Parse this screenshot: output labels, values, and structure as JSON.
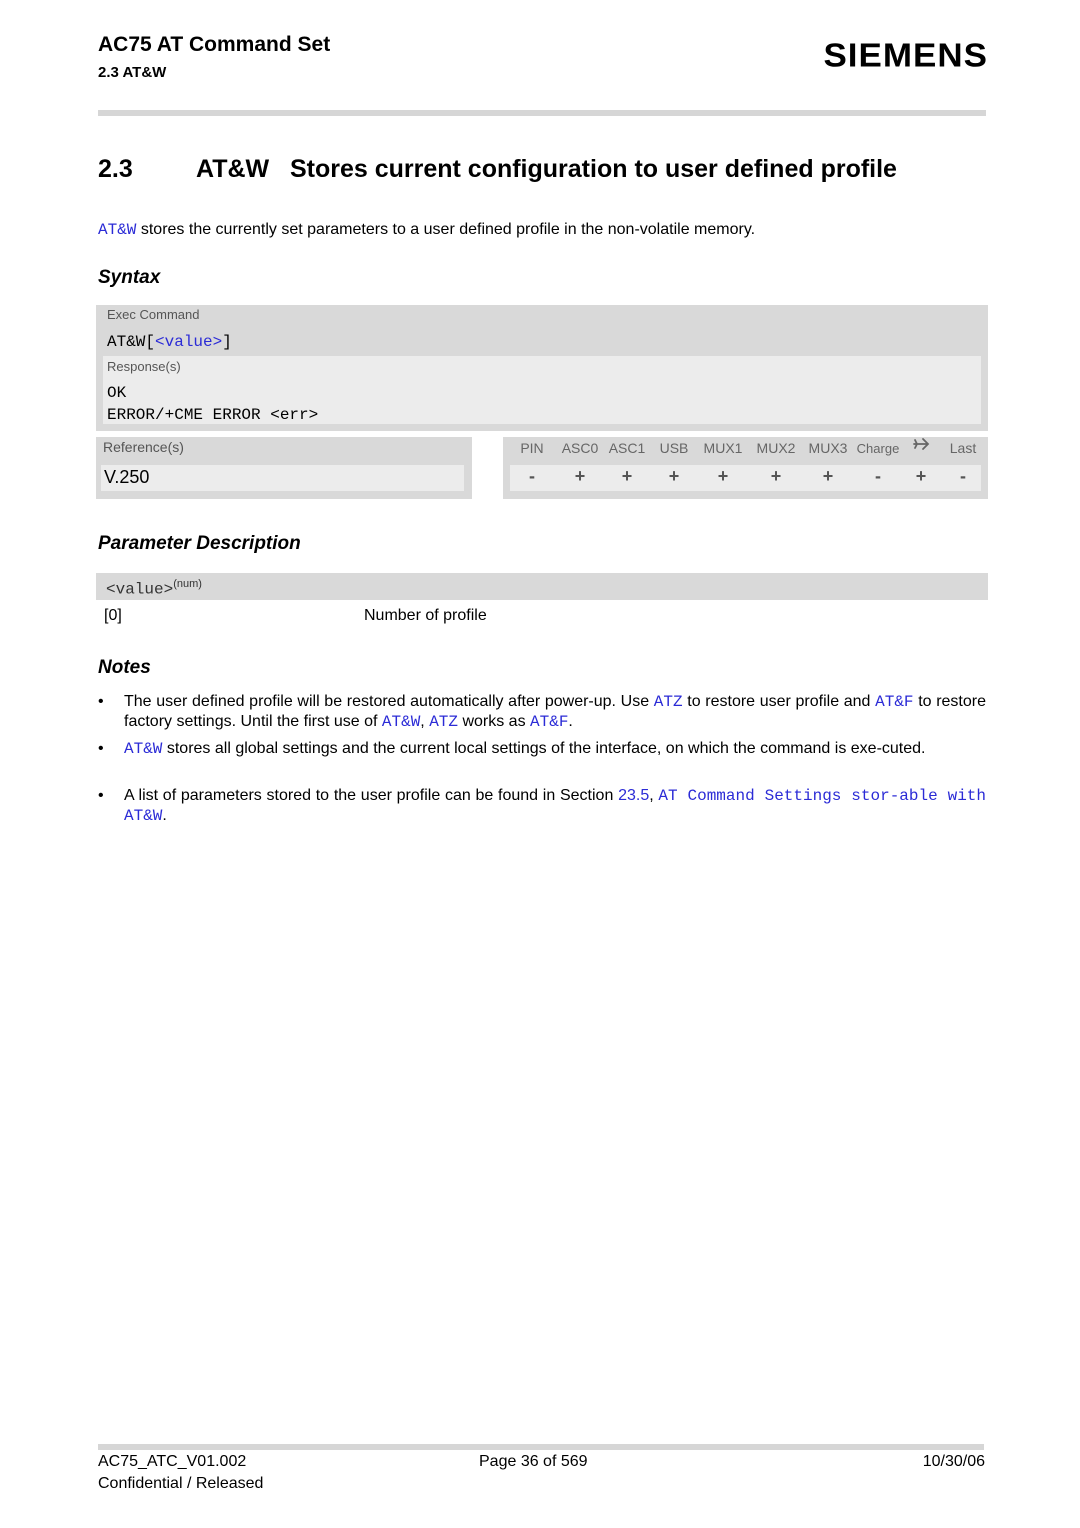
{
  "header": {
    "doc_title": "AC75 AT Command Set",
    "section": "2.3 AT&W",
    "logo": "SIEMENS"
  },
  "heading": {
    "number": "2.3",
    "title": "AT&W   Stores current configuration to user defined profile"
  },
  "intro": {
    "cmd_link": "AT&W",
    "text": " stores the currently set parameters to a user defined profile in the non-volatile memory."
  },
  "syntax": {
    "heading": "Syntax",
    "exec_label": "Exec Command",
    "exec_cmd_prefix": "AT&W[",
    "exec_cmd_param": "<value>",
    "exec_cmd_suffix": "]",
    "responses_label": "Response(s)",
    "responses": [
      "OK",
      "ERROR/+CME ERROR <err>"
    ],
    "references_label": "Reference(s)",
    "reference": "V.250",
    "interfaces": {
      "headers": [
        "PIN",
        "ASC0",
        "ASC1",
        "USB",
        "MUX1",
        "MUX2",
        "MUX3",
        "Charge",
        "airplane-icon",
        "Last"
      ],
      "values": [
        "-",
        "+",
        "+",
        "+",
        "+",
        "+",
        "+",
        "-",
        "+",
        "-"
      ]
    }
  },
  "parameters": {
    "heading": "Parameter Description",
    "name": "<value>",
    "type": "(num)",
    "rows": [
      {
        "value": "[0]",
        "description": "Number of profile"
      }
    ]
  },
  "notes": {
    "heading": "Notes",
    "bullet": "•",
    "items": [
      {
        "parts": [
          {
            "t": "The user defined profile will be restored automatically after power-up. Use "
          },
          {
            "t": "ATZ",
            "link": true
          },
          {
            "t": " to restore user profile and "
          },
          {
            "t": "AT&F",
            "link": true
          },
          {
            "t": " to restore factory settings. Until the first use of "
          },
          {
            "t": "AT&W",
            "link": true
          },
          {
            "t": ", "
          },
          {
            "t": "ATZ",
            "link": true
          },
          {
            "t": " works as "
          },
          {
            "t": "AT&F",
            "link": true
          },
          {
            "t": "."
          }
        ]
      },
      {
        "parts": [
          {
            "t": "AT&W",
            "link": true
          },
          {
            "t": " stores all global settings and the current local settings of the interface, on which the command is exe-cuted."
          }
        ]
      },
      {
        "parts": [
          {
            "t": "A list of parameters stored to the user profile can be found in Section "
          },
          {
            "t": "23.5",
            "link": true,
            "sans": true
          },
          {
            "t": ", "
          },
          {
            "t": "AT Command Settings stor-able with AT&W",
            "link": true
          },
          {
            "t": "."
          }
        ]
      }
    ]
  },
  "footer": {
    "doc_id": "AC75_ATC_V01.002",
    "page": "Page 36 of 569",
    "date": "10/30/06",
    "classification": "Confidential / Released"
  }
}
